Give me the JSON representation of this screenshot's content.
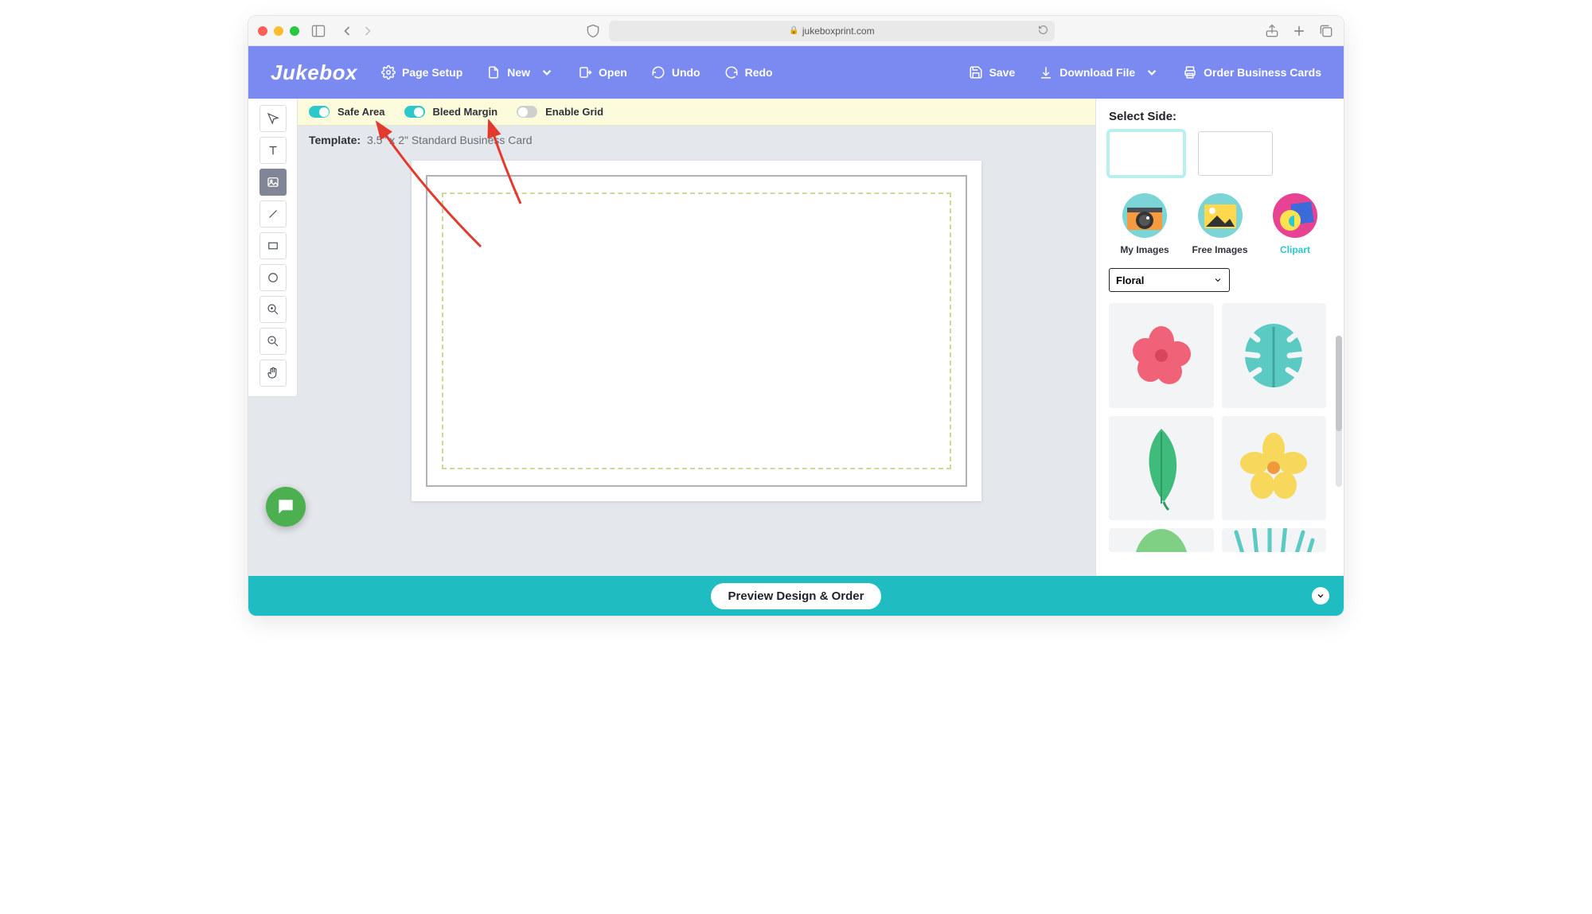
{
  "browser": {
    "url": "jukeboxprint.com"
  },
  "brand": "Jukebox",
  "topbar": {
    "page_setup": "Page Setup",
    "new": "New",
    "open": "Open",
    "undo": "Undo",
    "redo": "Redo",
    "save": "Save",
    "download": "Download File",
    "order": "Order Business Cards"
  },
  "options": {
    "safe_area_label": "Safe Area",
    "safe_area_on": true,
    "bleed_label": "Bleed Margin",
    "bleed_on": true,
    "grid_label": "Enable Grid",
    "grid_on": false
  },
  "template": {
    "label": "Template:",
    "value": "3.5\" x 2\" Standard Business Card"
  },
  "right": {
    "select_side_label": "Select Side:",
    "tabs": {
      "my": "My Images",
      "free": "Free Images",
      "clipart": "Clipart"
    },
    "category": "Floral",
    "clips": [
      "hibiscus-flower",
      "monstera-leaf",
      "green-leaf",
      "yellow-flower",
      "plant-top",
      "grass-top"
    ]
  },
  "bottom": {
    "preview": "Preview Design & Order"
  }
}
